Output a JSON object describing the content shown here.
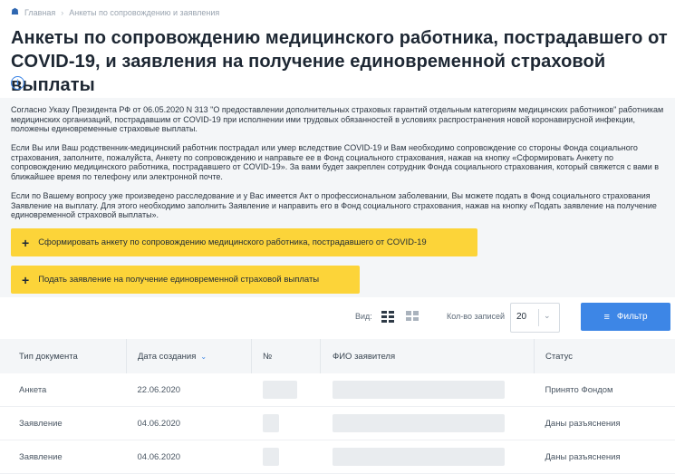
{
  "breadcrumb": {
    "home": "Главная",
    "current": "Анкеты по сопровождению и заявления"
  },
  "page_title": "Анкеты по сопровождению медицинского работника, пострадавшего от COVID-19, и заявления на получение единовременной страховой выплаты",
  "intro": {
    "p1": "Согласно Указу Президента РФ от 06.05.2020 N 313 \"О предоставлении дополнительных страховых гарантий отдельным категориям медицинских работников\" работникам медицинских организаций, пострадавшим от COVID-19 при исполнении ими трудовых обязанностей в условиях распространения новой коронавирусной инфекции, положены единовременные страховые выплаты.",
    "p2": "Если Вы или Ваш родственник-медицинский работник пострадал или умер вследствие COVID-19 и Вам необходимо сопровождение со стороны Фонда социального страхования, заполните, пожалуйста, Анкету по сопровождению и направьте ее в Фонд социального страхования, нажав на кнопку «Сформировать Анкету по сопровождению медицинского работника, пострадавшего от COVID-19». За вами будет закреплен сотрудник Фонда социального страхования, который свяжется с вами в ближайшее время по телефону или электронной почте.",
    "p3": "Если по Вашему вопросу уже произведено расследование и у Вас имеется Акт о профессиональном заболевании, Вы можете подать в Фонд социального страхования Заявление на выплату. Для этого необходимо заполнить Заявление и направить его в Фонд социального страхования, нажав на кнопку «Подать заявление на получение единовременной страховой выплаты»."
  },
  "buttons": {
    "form_questionnaire": "Сформировать анкету по сопровождению медицинского работника, пострадавшего от COVID-19",
    "submit_application": "Подать заявление на получение единовременной страховой выплаты",
    "filter": "Фильтр"
  },
  "toolbar": {
    "view_label": "Вид:",
    "count_label": "Кол-во записей",
    "count_value": "20"
  },
  "table": {
    "headers": [
      "Тип документа",
      "Дата создания",
      "№",
      "ФИО заявителя",
      "Статус"
    ],
    "rows": [
      {
        "type": "Анкета",
        "date": "22.06.2020",
        "status": "Принято Фондом"
      },
      {
        "type": "Заявление",
        "date": "04.06.2020",
        "status": "Даны разъяснения"
      },
      {
        "type": "Заявление",
        "date": "04.06.2020",
        "status": "Даны разъяснения"
      }
    ]
  },
  "colors": {
    "accent": "#3d86e6",
    "button_yellow": "#fcd439",
    "panel_bg": "#f4f6f8"
  },
  "icons": [
    "home-icon",
    "chevron-right-icon",
    "info-icon",
    "plus-icon",
    "list-view-icon",
    "grid-view-icon",
    "chevron-down-icon",
    "filter-icon",
    "sort-down-icon"
  ]
}
